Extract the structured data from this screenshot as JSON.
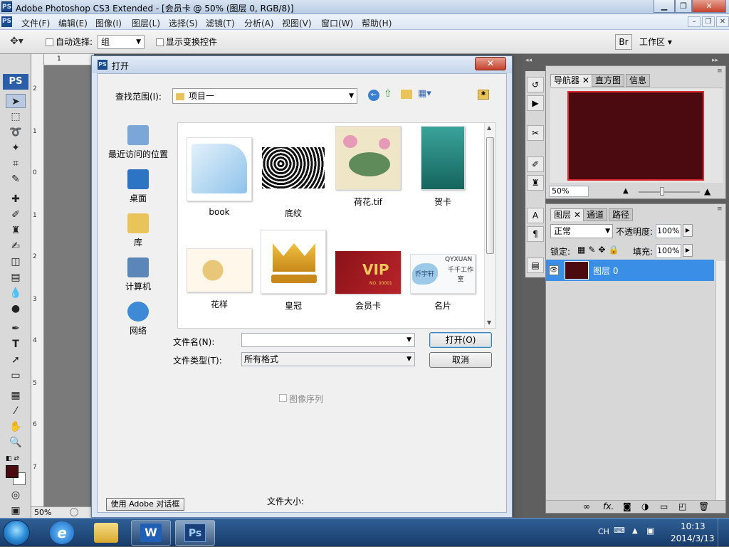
{
  "titlebar": {
    "app_icon": "PS",
    "title": "Adobe Photoshop CS3 Extended - [会员卡 @ 50% (图层 0, RGB/8)]",
    "min": "▁",
    "max": "❐",
    "close": "✕"
  },
  "menubar": {
    "items": [
      {
        "label": "文件(F)"
      },
      {
        "label": "编辑(E)"
      },
      {
        "label": "图像(I)"
      },
      {
        "label": "图层(L)"
      },
      {
        "label": "选择(S)"
      },
      {
        "label": "滤镜(T)"
      },
      {
        "label": "分析(A)"
      },
      {
        "label": "视图(V)"
      },
      {
        "label": "窗口(W)"
      },
      {
        "label": "帮助(H)"
      }
    ],
    "doc_min": "–",
    "doc_restore": "❐",
    "doc_close": "✕"
  },
  "optionsbar": {
    "auto_select_label": "自动选择:",
    "auto_select_value": "组",
    "show_transform_label": "显示变换控件",
    "workspace_label": "工作区 ▾"
  },
  "ruler": {
    "h_tick": "1",
    "v_ticks": [
      "2",
      "1",
      "0",
      "1",
      "2",
      "3",
      "4",
      "5",
      "6",
      "7"
    ]
  },
  "statusbar": {
    "zoom": "50%"
  },
  "dialog": {
    "title": "打开",
    "close": "✕",
    "lookin_label": "查找范围(I):",
    "lookin_value": "项目一",
    "places": [
      {
        "label": "最近访问的位置",
        "icon": "recent-icon",
        "color": "#7aa6d8"
      },
      {
        "label": "桌面",
        "icon": "desktop-icon",
        "color": "#2d74c4"
      },
      {
        "label": "库",
        "icon": "library-icon",
        "color": "#e9c45a"
      },
      {
        "label": "计算机",
        "icon": "computer-icon",
        "color": "#5a86b8"
      },
      {
        "label": "网络",
        "icon": "network-icon",
        "color": "#3e8ad6"
      }
    ],
    "files": [
      {
        "name": "book"
      },
      {
        "name": "底纹"
      },
      {
        "name": "荷花.tif"
      },
      {
        "name": "贺卡"
      },
      {
        "name": "花样"
      },
      {
        "name": "皇冠"
      },
      {
        "name": "会员卡"
      },
      {
        "name": "名片"
      }
    ],
    "filename_label": "文件名(N):",
    "filename_value": "",
    "filetype_label": "文件类型(T):",
    "filetype_value": "所有格式",
    "open_button": "打开(O)",
    "cancel_button": "取消",
    "image_sequence_label": "图像序列",
    "filesize_label": "文件大小:",
    "adobe_dialog_button": "使用 Adobe 对话框",
    "thumb_texts": {
      "vip": "VIP",
      "vip_sub": "NO. 00001",
      "card_brand": "QYXUAN",
      "card_title": "千千工作室",
      "card_logo": "乔宇轩"
    }
  },
  "navigator": {
    "tabs": [
      "导航器",
      "直方图",
      "信息"
    ],
    "zoom": "50%",
    "preview_color": "#4a0a0f"
  },
  "layers": {
    "tabs": [
      "图层",
      "通道",
      "路径"
    ],
    "blend_mode": "正常",
    "opacity_label": "不透明度:",
    "opacity_value": "100%",
    "lock_label": "锁定:",
    "fill_label": "填充:",
    "fill_value": "100%",
    "layer_name": "图层 0",
    "footer_icons": [
      "link-icon",
      "fx-icon",
      "mask-icon",
      "adjust-icon",
      "folder-icon",
      "new-layer-icon",
      "trash-icon"
    ],
    "fx_label": "fx."
  },
  "taskbar": {
    "lang": "CH",
    "time": "10:13",
    "date": "2014/3/13",
    "ps_label": "Ps",
    "word_label": "W"
  },
  "colors": {
    "selection_blue": "#3a8ee6",
    "foreground_swatch": "#4a0a0f"
  }
}
